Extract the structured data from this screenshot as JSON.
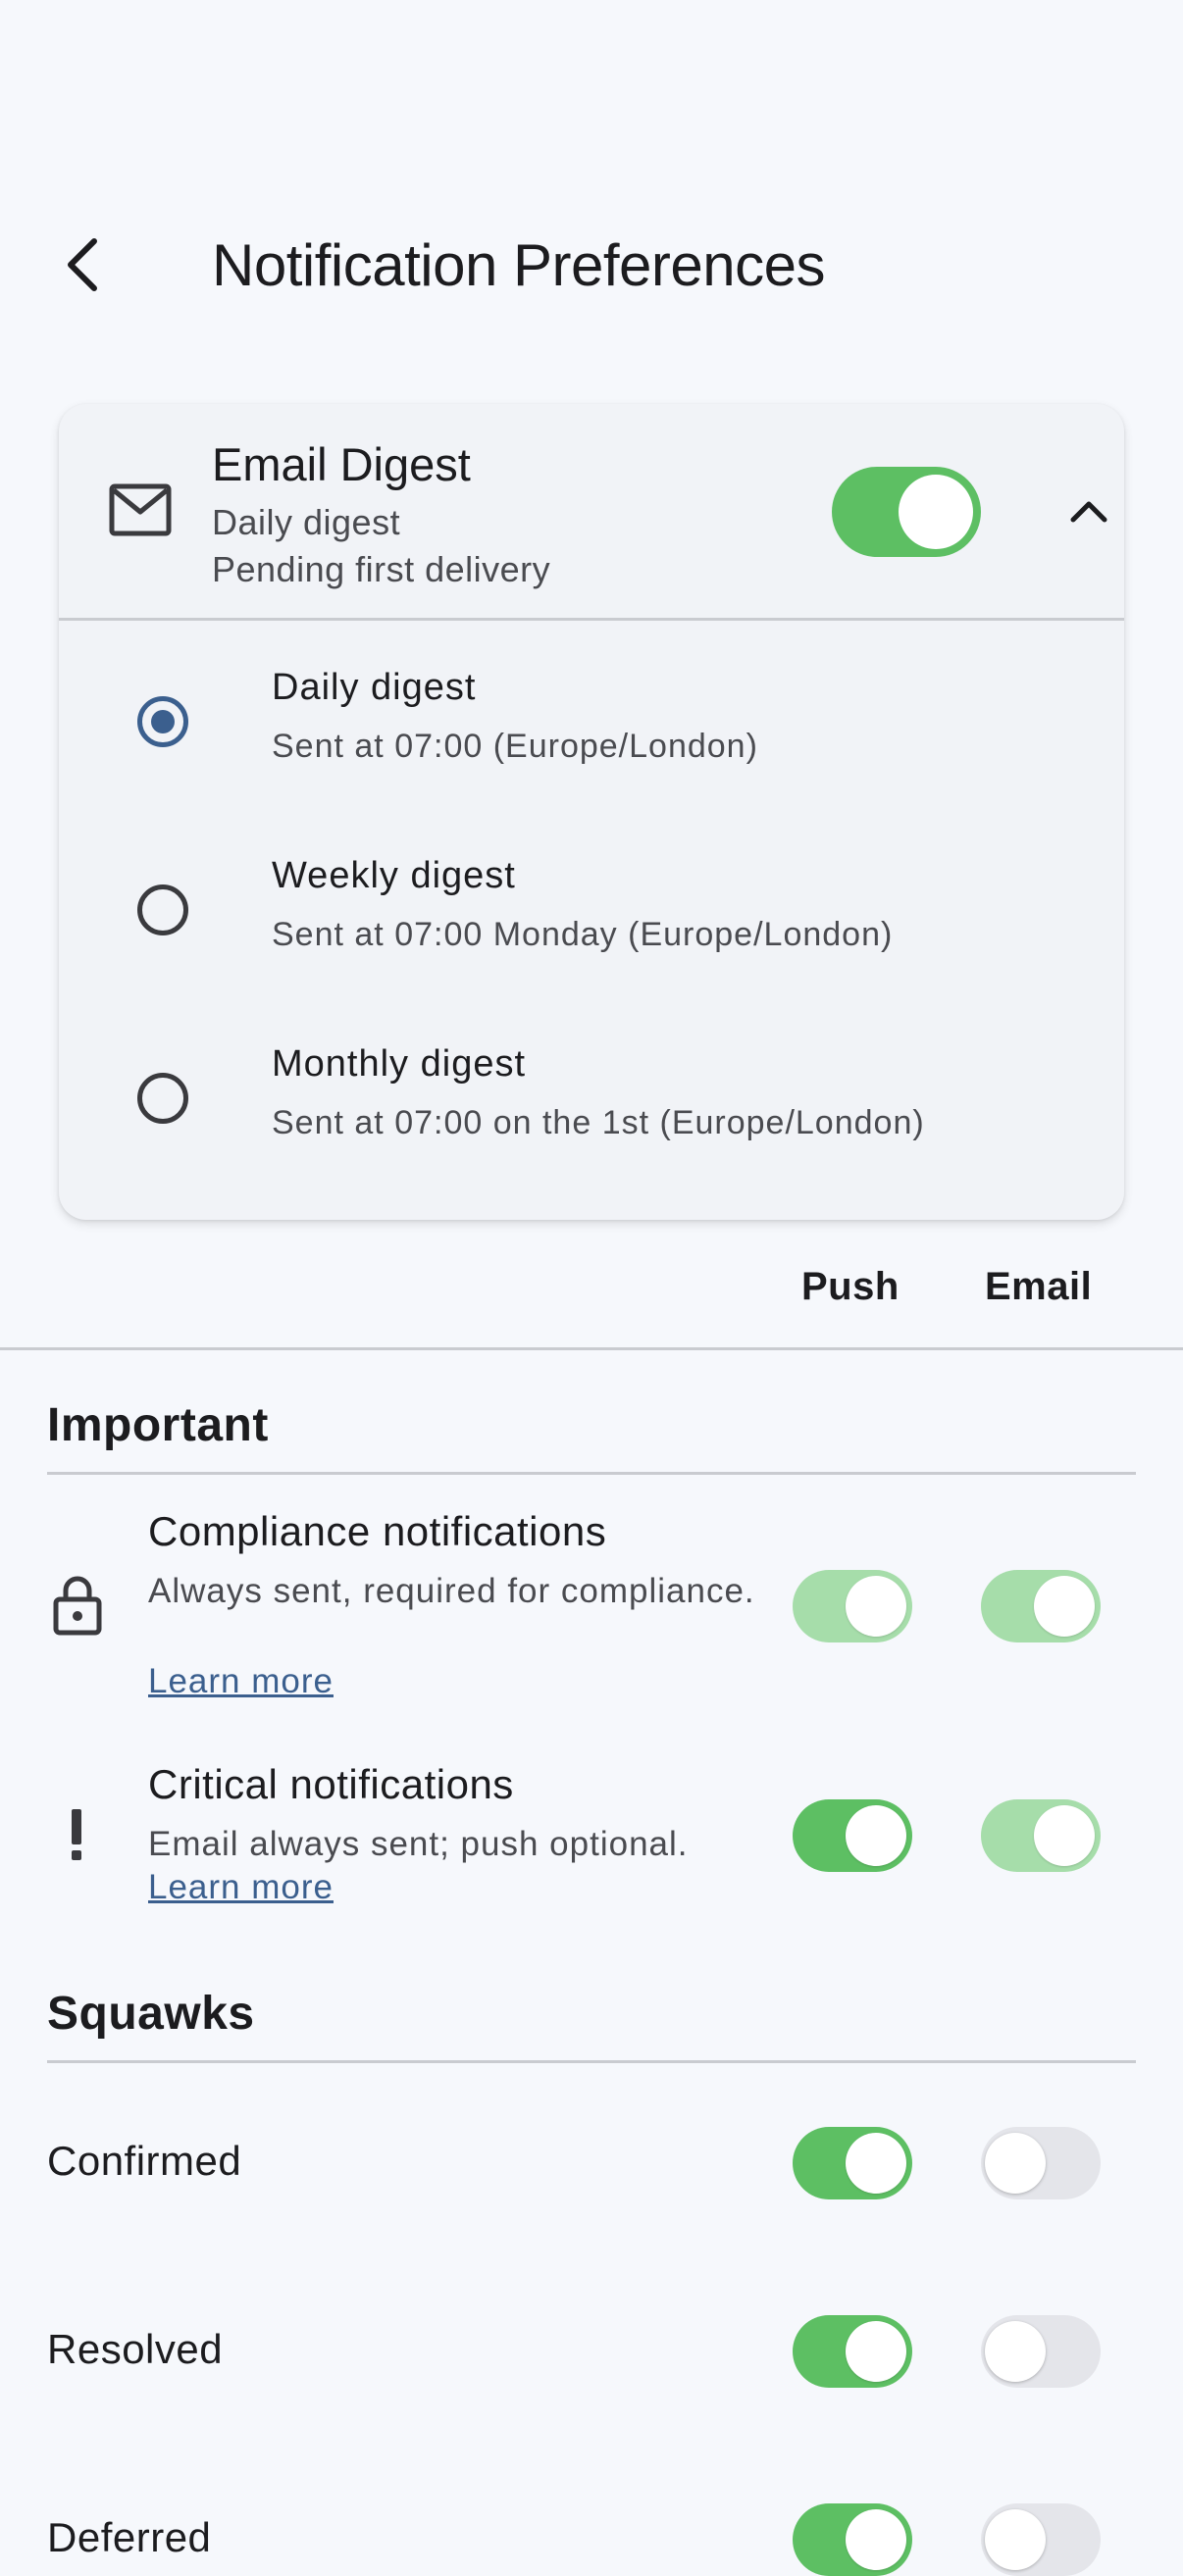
{
  "header": {
    "title": "Notification Preferences"
  },
  "digest": {
    "title": "Email Digest",
    "subtitle": "Daily digest",
    "status": "Pending first delivery",
    "enabled": true,
    "options": [
      {
        "label": "Daily digest",
        "description": "Sent at 07:00 (Europe/London)",
        "selected": true
      },
      {
        "label": "Weekly digest",
        "description": "Sent at 07:00 Monday (Europe/London)",
        "selected": false
      },
      {
        "label": "Monthly digest",
        "description": "Sent at 07:00 on the 1st (Europe/London)",
        "selected": false
      }
    ]
  },
  "columns": {
    "push": "Push",
    "email": "Email"
  },
  "important": {
    "title": "Important",
    "compliance": {
      "title": "Compliance notifications",
      "description": "Always sent, required for compliance.",
      "link": "Learn more",
      "push": "on-disabled",
      "email": "on-disabled"
    },
    "critical": {
      "title": "Critical notifications",
      "description": "Email always sent; push optional.",
      "link": "Learn more",
      "push": "on",
      "email": "on-disabled"
    }
  },
  "squawks": {
    "title": "Squawks",
    "items": [
      {
        "label": "Confirmed",
        "push": "on",
        "email": "off"
      },
      {
        "label": "Resolved",
        "push": "on",
        "email": "off"
      },
      {
        "label": "Deferred",
        "push": "on",
        "email": "off"
      }
    ]
  },
  "colors": {
    "accent_green": "#5dbf63",
    "disabled_green": "#a6ddaa",
    "radio_blue": "#3b5f8e",
    "background": "#f6f8fc"
  }
}
